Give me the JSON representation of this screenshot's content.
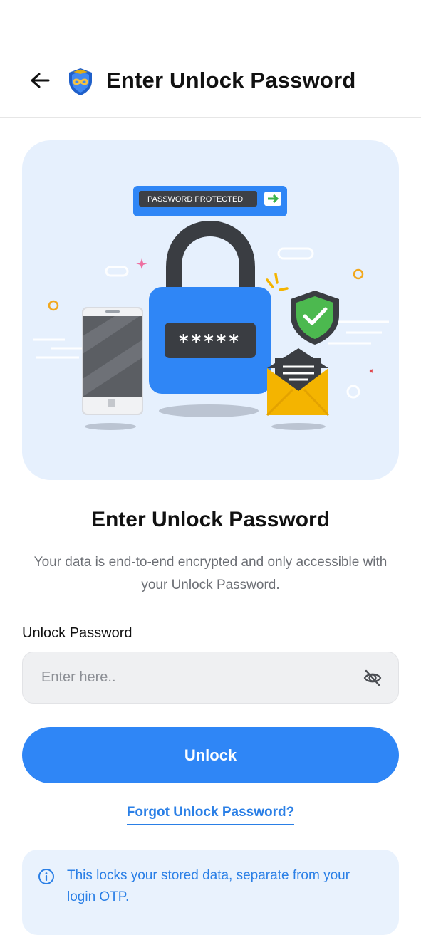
{
  "header": {
    "title": "Enter Unlock Password",
    "back_icon": "arrow-left-icon",
    "logo_icon": "shield-infinity-logo"
  },
  "illustration": {
    "banner_text": "PASSWORD PROTECTED",
    "lock_mask": "*****",
    "icons": [
      "padlock-icon",
      "smartphone-icon",
      "shield-check-icon",
      "envelope-icon"
    ]
  },
  "main": {
    "heading": "Enter Unlock Password",
    "subtitle": "Your data is end-to-end encrypted and only accessible with your Unlock Password."
  },
  "password_field": {
    "label": "Unlock Password",
    "placeholder": "Enter here..",
    "value": "",
    "toggle_icon": "eye-off-icon"
  },
  "actions": {
    "unlock_label": "Unlock",
    "forgot_label": "Forgot Unlock Password?"
  },
  "info": {
    "icon": "info-icon",
    "text": "This locks your stored data, separate from your login OTP."
  },
  "colors": {
    "primary": "#2f86f6",
    "link": "#2a7fe6",
    "hero_bg": "#e6f0fd",
    "info_bg": "#e9f2fd"
  }
}
